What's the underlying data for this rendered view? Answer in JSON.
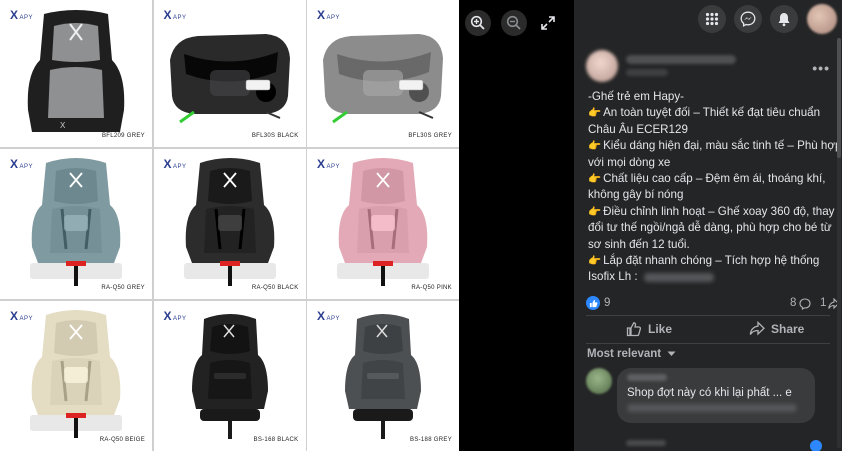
{
  "viewer": {
    "tiles": [
      {
        "brand": "HAPY",
        "model": "BFL209 GREY",
        "color": "#8f9091",
        "style": "highback"
      },
      {
        "brand": "HAPY",
        "model": "BFL30S BLACK",
        "color": "#2a2a2b",
        "style": "booster"
      },
      {
        "brand": "HAPY",
        "model": "BFL30S GREY",
        "color": "#8c8c8c",
        "style": "booster"
      },
      {
        "brand": "HAPY",
        "model": "RA-Q50 GREY",
        "color": "#7f9aa1",
        "style": "convertible"
      },
      {
        "brand": "HAPY",
        "model": "RA-Q50 BLACK",
        "color": "#2c2c2d",
        "style": "convertible"
      },
      {
        "brand": "HAPY",
        "model": "RA-Q50 PINK",
        "color": "#e3a9b6",
        "style": "convertible"
      },
      {
        "brand": "HAPY",
        "model": "RA-Q50 BEIGE",
        "color": "#e5dcc4",
        "style": "convertible"
      },
      {
        "brand": "HAPY",
        "model": "BS-168 BLACK",
        "color": "#222223",
        "style": "spin"
      },
      {
        "brand": "HAPY",
        "model": "BS-188 GREY",
        "color": "#4d5052",
        "style": "spin"
      }
    ],
    "tools": {
      "zoom_in_icon": "zoom-in-icon",
      "zoom_out_icon": "zoom-out-icon",
      "fullscreen_icon": "expand-icon"
    }
  },
  "post": {
    "lines": [
      {
        "hand": false,
        "text": "-Ghế trẻ em Hapy-"
      },
      {
        "hand": true,
        "text": "An toàn tuyệt đối – Thiết kế đạt tiêu chuẩn"
      },
      {
        "hand": false,
        "text": "Châu Âu ECER129"
      },
      {
        "hand": true,
        "text": "Kiểu dáng hiện đại, màu sắc tinh tế – Phù hợp"
      },
      {
        "hand": false,
        "text": "với mọi dòng xe"
      },
      {
        "hand": true,
        "text": "Chất liệu cao cấp – Đệm êm ái, thoáng khí,"
      },
      {
        "hand": false,
        "text": "không gây bí nóng"
      },
      {
        "hand": true,
        "text": "Điều chỉnh linh hoạt – Ghế xoay 360 độ, thay"
      },
      {
        "hand": false,
        "text": "đổi tư thế ngồi/ngả dễ dàng, phù hợp cho bé từ"
      },
      {
        "hand": false,
        "text": "sơ sinh đến 12 tuổi."
      },
      {
        "hand": true,
        "text": "Lắp đặt nhanh chóng – Tích hợp hệ thống"
      },
      {
        "hand": false,
        "text": "Isofix Lh :"
      }
    ],
    "reactions": {
      "likes": "9",
      "comments": "8",
      "shares": "1"
    },
    "actions": {
      "like": "Like",
      "share": "Share"
    },
    "sort_label": "Most relevant",
    "comment": {
      "text": "Shop đợt này có khi lại phất ... e"
    }
  },
  "colors": {
    "accent": "#2d88ff",
    "panel_bg": "#242526",
    "text": "#e4e6eb",
    "muted": "#b0b3b8"
  }
}
